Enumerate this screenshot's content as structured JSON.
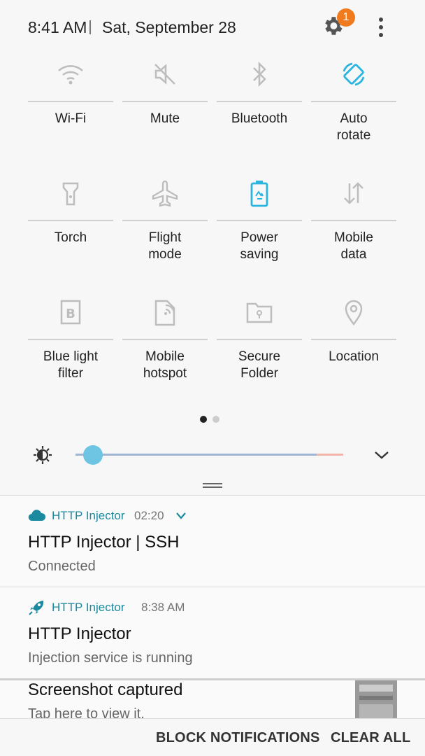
{
  "status_bar": {
    "time": "8:41 AM",
    "date": "Sat, September 28",
    "settings_badge": "1"
  },
  "tiles": [
    {
      "label": "Wi-Fi",
      "icon": "wifi-icon",
      "active": false
    },
    {
      "label": "Mute",
      "icon": "mute-icon",
      "active": false
    },
    {
      "label": "Bluetooth",
      "icon": "bluetooth-icon",
      "active": false
    },
    {
      "label": "Auto\nrotate",
      "icon": "auto-rotate-icon",
      "active": true
    },
    {
      "label": "Torch",
      "icon": "torch-icon",
      "active": false
    },
    {
      "label": "Flight\nmode",
      "icon": "airplane-icon",
      "active": false
    },
    {
      "label": "Power\nsaving",
      "icon": "battery-recycle-icon",
      "active": true
    },
    {
      "label": "Mobile\ndata",
      "icon": "mobile-data-icon",
      "active": false
    },
    {
      "label": "Blue light\nfilter",
      "icon": "blue-light-filter-icon",
      "active": false
    },
    {
      "label": "Mobile\nhotspot",
      "icon": "hotspot-icon",
      "active": false
    },
    {
      "label": "Secure\nFolder",
      "icon": "secure-folder-icon",
      "active": false
    },
    {
      "label": "Location",
      "icon": "location-icon",
      "active": false
    }
  ],
  "page_indicator": {
    "current": 1,
    "total": 2
  },
  "brightness": {
    "level": 0.03
  },
  "notifications": [
    {
      "app": "HTTP Injector",
      "time": "02:20",
      "title": "HTTP Injector | SSH",
      "text": "Connected",
      "icon": "cloud-icon"
    },
    {
      "app": "HTTP Injector",
      "time": "8:38 AM",
      "title": "HTTP Injector",
      "text": "Injection service is running",
      "icon": "rocket-icon"
    },
    {
      "app": "",
      "time": "",
      "title": "Screenshot captured",
      "text": "Tap here to view it.",
      "icon": "screenshot-thumbnail"
    }
  ],
  "actions": {
    "block": "BLOCK NOTIFICATIONS",
    "clear": "CLEAR ALL"
  },
  "colors": {
    "accent": "#2ab5e0",
    "app_name": "#1b8a9e",
    "badge": "#f07a1e"
  }
}
